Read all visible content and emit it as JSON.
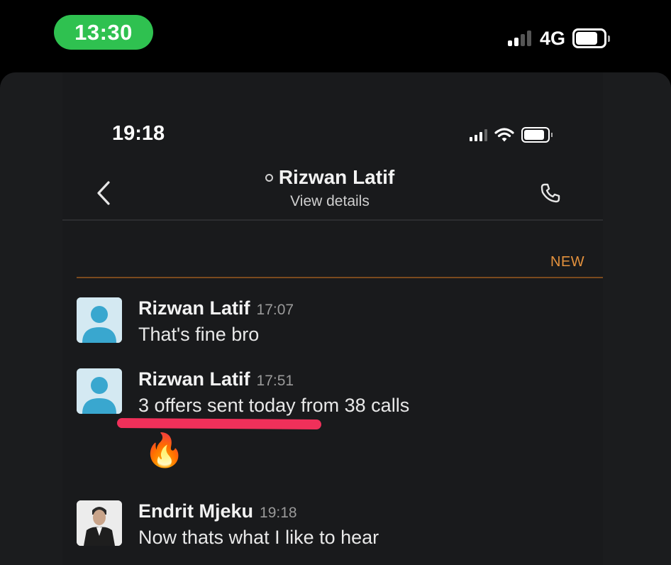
{
  "outer_status": {
    "time": "13:30",
    "network": "4G"
  },
  "inner_status": {
    "time": "19:18"
  },
  "header": {
    "contact_name": "Rizwan Latif",
    "subtitle": "View details"
  },
  "new_divider": {
    "label": "NEW"
  },
  "messages": [
    {
      "sender": "Rizwan Latif",
      "time": "17:07",
      "text": "That's fine bro"
    },
    {
      "sender": "Rizwan Latif",
      "time": "17:51",
      "text": "3 offers sent today from 38 calls",
      "reaction": "🔥"
    },
    {
      "sender": "Endrit Mjeku",
      "time": "19:18",
      "text": "Now thats what I like to hear"
    }
  ],
  "colors": {
    "outer_time_pill": "#2fc150",
    "new_label": "#e3913d",
    "highlight_underline": "#f0305a",
    "background": "#191a1c"
  },
  "icons": [
    "signal-icon",
    "battery-icon",
    "wifi-icon",
    "back-chevron-icon",
    "phone-icon",
    "presence-dot-icon",
    "default-avatar-icon",
    "fire-emoji"
  ]
}
